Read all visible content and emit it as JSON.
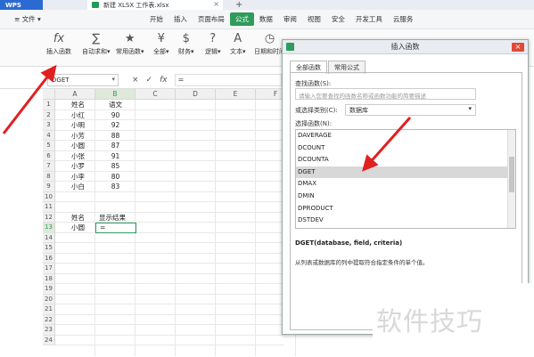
{
  "titlebar": {
    "app": "WPS",
    "doc_tab": "新建 XLSX 工作表.xlsx",
    "close_glyph": "×",
    "new_tab_glyph": "+"
  },
  "menubar": {
    "items": [
      "≡ 文件 ▾",
      "开始",
      "插入",
      "页面布局",
      "公式",
      "数据",
      "审阅",
      "视图",
      "安全",
      "开发工具",
      "云服务"
    ],
    "active": "公式",
    "accent": "#2e9c5a"
  },
  "ribbon": {
    "buttons": [
      {
        "glyph": "fx",
        "label": "插入函数"
      },
      {
        "glyph": "∑",
        "label": "自动求和▾"
      },
      {
        "glyph": "★",
        "label": "常用函数▾"
      },
      {
        "glyph": "¥",
        "label": "全部▾"
      },
      {
        "glyph": "$",
        "label": "财务▾"
      },
      {
        "glyph": "?",
        "label": "逻辑▾"
      },
      {
        "glyph": "A",
        "label": "文本▾"
      },
      {
        "glyph": "◷",
        "label": "日期和时间"
      }
    ]
  },
  "formula_bar": {
    "name_box": "DGET",
    "cancel": "×",
    "confirm": "✓",
    "fx": "fx",
    "value": "="
  },
  "sheet": {
    "columns": [
      "A",
      "B",
      "C",
      "D",
      "E",
      "F"
    ],
    "rows": [
      "1",
      "2",
      "3",
      "4",
      "5",
      "6",
      "7",
      "8",
      "9",
      "10",
      "11",
      "12",
      "13",
      "14",
      "15",
      "16",
      "17",
      "18",
      "19",
      "20",
      "21",
      "22",
      "23",
      "24"
    ],
    "data": [
      {
        "a": "姓名",
        "b": "语文"
      },
      {
        "a": "小红",
        "b": "90"
      },
      {
        "a": "小明",
        "b": "92"
      },
      {
        "a": "小芳",
        "b": "88"
      },
      {
        "a": "小圆",
        "b": "87"
      },
      {
        "a": "小张",
        "b": "91"
      },
      {
        "a": "小罗",
        "b": "85"
      },
      {
        "a": "小李",
        "b": "80"
      },
      {
        "a": "小白",
        "b": "83"
      }
    ],
    "lookup_header": {
      "a": "姓名",
      "b": "显示结果"
    },
    "lookup_row": {
      "a": "小圆",
      "b": "="
    }
  },
  "dialog": {
    "title": "插入函数",
    "tabs": [
      "全部函数",
      "常用公式"
    ],
    "search_label": "查找函数(S):",
    "search_placeholder": "请输入您要查找的函数名称或函数功能的简要描述",
    "category_label": "或选择类别(C):",
    "category_value": "数据库",
    "select_label": "选择函数(N):",
    "functions": [
      "DAVERAGE",
      "DCOUNT",
      "DCOUNTA",
      "DGET",
      "DMAX",
      "DMIN",
      "DPRODUCT",
      "DSTDEV"
    ],
    "selected": "DGET",
    "signature": "DGET(database, field, criteria)",
    "description": "从列表或数据库的列中提取符合指定条件的单个值。"
  },
  "watermark": "软件技巧"
}
